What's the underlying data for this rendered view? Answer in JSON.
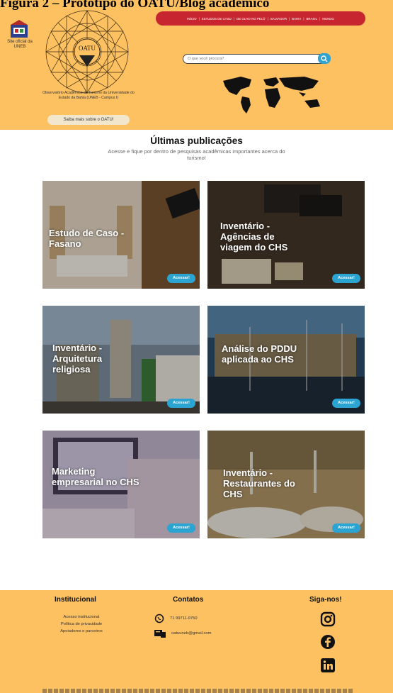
{
  "figure_caption": "Figura 2 – Protótipo do OATU/Blog acadêmico",
  "header": {
    "site_oficial": "Site oficial da UNEB",
    "logo_text": "OATU",
    "observatorio": "Observatório Acadêmico de Turismo da Universidade do Estado da Bahia (UNEB - Campus I)",
    "saiba_mais": "Saiba mais sobre o OATU!",
    "nav": [
      "INÍCIO",
      "ESTUDOS DE CASO",
      "DE OLHO NO PELÔ",
      "SALVADOR",
      "BAHIA",
      "BRASIL",
      "MUNDO"
    ],
    "search_placeholder": "O que você procura?"
  },
  "section": {
    "title": "Últimas publicações",
    "subtitle": "Acesse e fique por dentro de pesquisas acadêmicas importantes acerca do turismo!"
  },
  "cards": [
    {
      "title": "Estudo de Caso - Fasano",
      "button": "Acessar!"
    },
    {
      "title": "Inventário - Agências de viagem do CHS",
      "button": "Acessar!"
    },
    {
      "title": "Inventário - Arquitetura religiosa",
      "button": "Acessar!"
    },
    {
      "title": "Análise do PDDU aplicada ao CHS",
      "button": "Acessar!"
    },
    {
      "title": "Marketing empresarial no CHS",
      "button": "Acessar!"
    },
    {
      "title": "Inventário - Restaurantes do CHS",
      "button": "Acessar!"
    }
  ],
  "footer": {
    "institucional_title": "Institucional",
    "institucional_links": [
      "Acesso institucional",
      "Política de privacidade",
      "Apoiadores e parceiros"
    ],
    "contatos_title": "Contatos",
    "phone": "71 99711-9750",
    "email": "oatuuneb@gmail.com",
    "siga_title": "Siga-nos!"
  },
  "colors": {
    "header_bg": "#fdc162",
    "nav_bg": "#c7252f",
    "button": "#2ba4d2"
  }
}
